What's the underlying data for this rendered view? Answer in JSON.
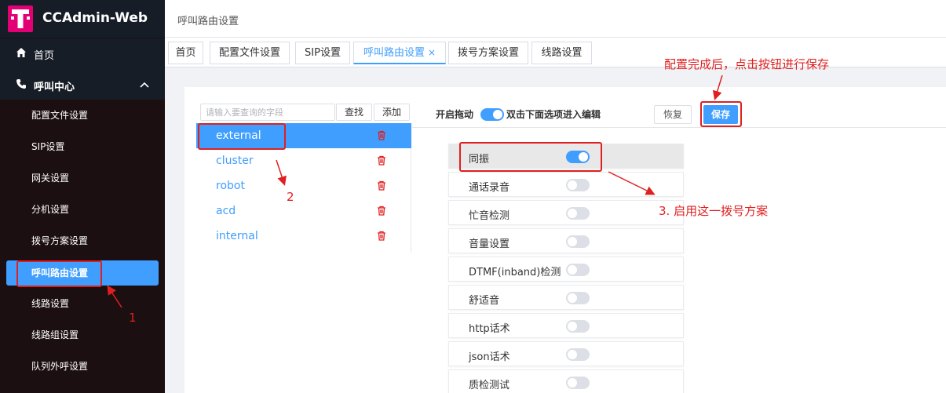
{
  "app": {
    "title": "CCAdmin-Web",
    "logo_letter": "T",
    "brand_color": "#e20074",
    "accent_color": "#409eff"
  },
  "sidebar": {
    "home": {
      "icon": "home-icon",
      "label": "首页"
    },
    "group": {
      "icon": "phone-icon",
      "label": "呼叫中心",
      "expanded": true
    },
    "items": [
      {
        "label": "配置文件设置"
      },
      {
        "label": "SIP设置"
      },
      {
        "label": "网关设置"
      },
      {
        "label": "分机设置"
      },
      {
        "label": "拨号方案设置"
      },
      {
        "label": "呼叫路由设置",
        "active": true
      },
      {
        "label": "线路设置"
      },
      {
        "label": "线路组设置"
      },
      {
        "label": "队列外呼设置"
      }
    ]
  },
  "header": {
    "title": "呼叫路由设置"
  },
  "tabs": [
    {
      "label": "首页"
    },
    {
      "label": "配置文件设置"
    },
    {
      "label": "SIP设置"
    },
    {
      "label": "呼叫路由设置",
      "active": true,
      "close": "×"
    },
    {
      "label": "拨号方案设置"
    },
    {
      "label": "线路设置"
    }
  ],
  "search": {
    "placeholder": "请输入要查询的字段",
    "value": "",
    "search_label": "查找",
    "add_label": "添加"
  },
  "routes": [
    {
      "name": "external",
      "active": true
    },
    {
      "name": "cluster"
    },
    {
      "name": "robot"
    },
    {
      "name": "acd"
    },
    {
      "name": "internal"
    }
  ],
  "toolbar": {
    "drag_label": "开启拖动",
    "drag_enabled": true,
    "hint": "双击下面选项进入编辑",
    "restore_label": "恢复",
    "save_label": "保存"
  },
  "options": [
    {
      "label": "同振",
      "enabled": true
    },
    {
      "label": "通话录音",
      "enabled": false
    },
    {
      "label": "忙音检测",
      "enabled": false
    },
    {
      "label": "音量设置",
      "enabled": false
    },
    {
      "label": "DTMF(inband)检测",
      "enabled": false
    },
    {
      "label": "舒适音",
      "enabled": false
    },
    {
      "label": "http话术",
      "enabled": false
    },
    {
      "label": "json话术",
      "enabled": false
    },
    {
      "label": "质检测试",
      "enabled": false
    }
  ],
  "annotations": {
    "save_hint": "配置完成后，点击按钮进行保存",
    "step1": "1",
    "step2": "2",
    "step3": "3. 启用这一拨号方案",
    "color": "#e02020"
  }
}
